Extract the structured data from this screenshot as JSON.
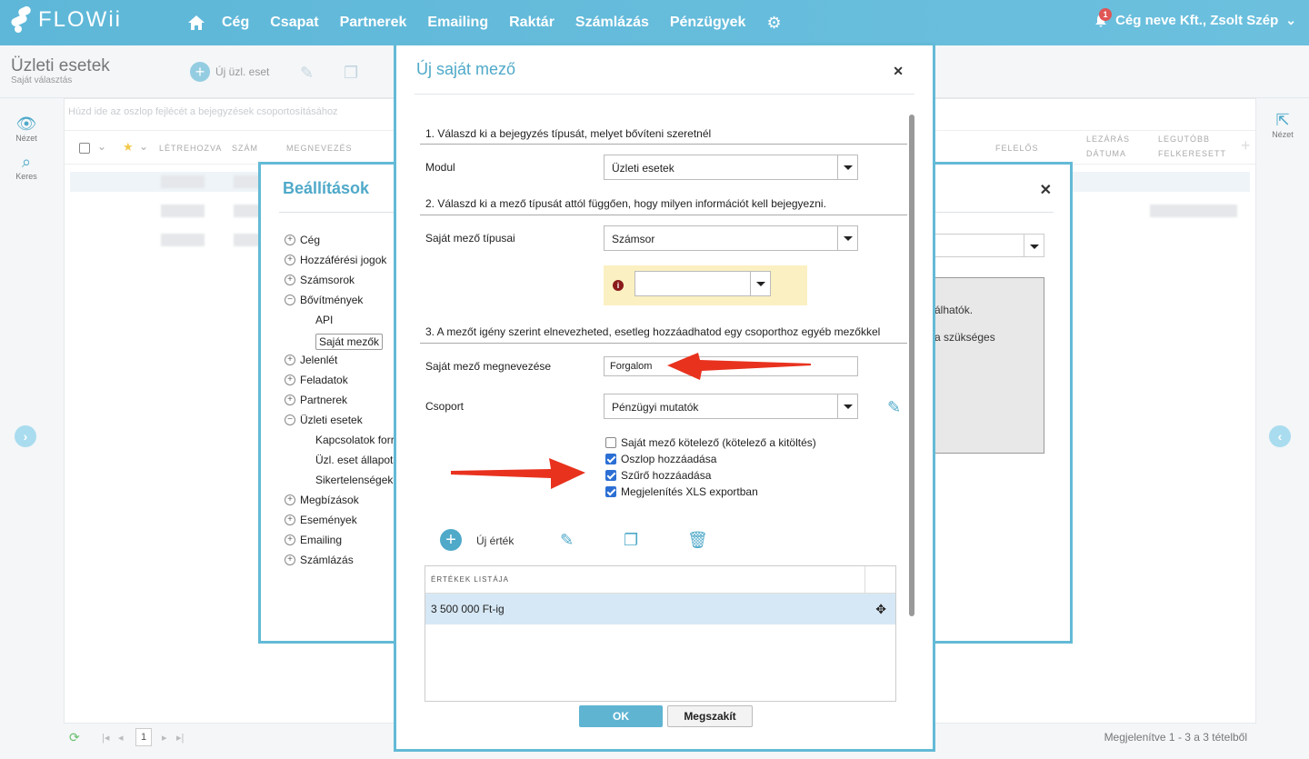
{
  "nav": {
    "logo": "FLOWii",
    "items": [
      "Cég",
      "Csapat",
      "Partnerek",
      "Emailing",
      "Raktár",
      "Számlázás",
      "Pénzügyek"
    ],
    "notification_count": "1",
    "user": "Cég neve Kft., Zsolt Szép"
  },
  "page": {
    "title": "Üzleti esetek",
    "subtitle": "Saját választás",
    "new_button": "Új üzl. eset",
    "group_hint": "Húzd ide az oszlop fejlécét a bejegyzések csoportosításához",
    "left_side": {
      "view": "Nézet",
      "search": "Keres"
    },
    "right_side": {
      "view": "Nézet"
    },
    "columns": [
      "LÉTREHOZVA",
      "SZÁM",
      "MEGNEVEZÉS",
      "FELELŐS",
      "LEZÁRÁS",
      "DÁTUMA",
      "LEGUTÓBB",
      "FELKERESETT"
    ],
    "pager": {
      "page": "1",
      "info": "Megjelenítve 1 - 3 a 3 tételből"
    }
  },
  "settings_modal": {
    "title": "Beállítások",
    "tree": [
      {
        "label": "Cég",
        "icon": "plus"
      },
      {
        "label": "Hozzáférési jogok",
        "icon": "plus"
      },
      {
        "label": "Számsorok",
        "icon": "plus"
      },
      {
        "label": "Bővítmények",
        "icon": "minus"
      },
      {
        "label": "API",
        "icon": "none"
      },
      {
        "label": "Saját mezők",
        "icon": "none"
      },
      {
        "label": "Jelenlét",
        "icon": "plus"
      },
      {
        "label": "Feladatok",
        "icon": "plus"
      },
      {
        "label": "Partnerek",
        "icon": "plus"
      },
      {
        "label": "Üzleti esetek",
        "icon": "minus"
      },
      {
        "label": "Kapcsolatok forr",
        "icon": "none"
      },
      {
        "label": "Üzl. eset állapota",
        "icon": "none"
      },
      {
        "label": "Sikertelenségek o",
        "icon": "none"
      },
      {
        "label": "Megbízások",
        "icon": "plus"
      },
      {
        "label": "Események",
        "icon": "plus"
      },
      {
        "label": "Emailing",
        "icon": "plus"
      },
      {
        "label": "Számlázás",
        "icon": "plus"
      }
    ],
    "box_text_1": "álhatók.",
    "box_text_2": "a szükséges"
  },
  "new_field_modal": {
    "title": "Új saját mező",
    "step1": "1. Válaszd ki a bejegyzés típusát, melyet bővíteni szeretnél",
    "module_label": "Modul",
    "module_value": "Üzleti esetek",
    "step2": "2. Válaszd ki a mező típusát attól függően, hogy milyen információt kell bejegyezni.",
    "type_label": "Saját mező típusai",
    "type_value": "Számsor",
    "step3": "3. A mezőt igény szerint elnevezheted, esetleg hozzáadhatod egy csoporthoz egyéb mezőkkel",
    "name_label": "Saját mező megnevezése",
    "name_value": "Forgalom",
    "group_label": "Csoport",
    "group_value": "Pénzügyi mutatók",
    "checkboxes": [
      {
        "label": "Saját mező kötelező (kötelező a kitöltés)",
        "checked": false
      },
      {
        "label": "Oszlop hozzáadása",
        "checked": true
      },
      {
        "label": "Szűrő hozzáadása",
        "checked": true
      },
      {
        "label": "Megjelenítés XLS exportban",
        "checked": true
      }
    ],
    "new_value_label": "Új érték",
    "values_header": "ÉRTÉKEK LISTÁJA",
    "values": [
      "3 500 000 Ft-ig"
    ],
    "ok": "OK",
    "cancel": "Megszakít"
  },
  "colors": {
    "accent": "#4fa9c9",
    "topbar": "#5eb7d8",
    "arrow": "#e8321e",
    "row_selected": "#d6e8f5",
    "warning_bg": "#fbf0c2"
  }
}
